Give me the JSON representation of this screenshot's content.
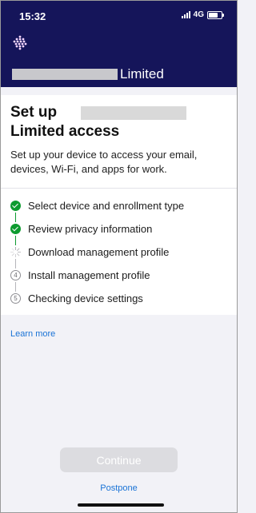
{
  "status_bar": {
    "time": "15:32",
    "network": "4G"
  },
  "header": {
    "org_name": "Limited"
  },
  "card": {
    "title_line1": "Set up",
    "title_line2": "Limited access",
    "subtitle": "Set up your device to access your email, devices, Wi-Fi, and apps for work."
  },
  "steps": [
    {
      "label": "Select device and enrollment type",
      "status": "done"
    },
    {
      "label": "Review privacy information",
      "status": "done"
    },
    {
      "label": "Download management profile",
      "status": "in-progress"
    },
    {
      "label": "Install management profile",
      "status": "pending",
      "number": "4"
    },
    {
      "label": "Checking device settings",
      "status": "pending",
      "number": "5"
    }
  ],
  "links": {
    "learn_more": "Learn more",
    "postpone": "Postpone"
  },
  "buttons": {
    "continue": "Continue"
  },
  "colors": {
    "header_bg": "#15155a",
    "done": "#0d9b2f",
    "link": "#1a73d6"
  }
}
